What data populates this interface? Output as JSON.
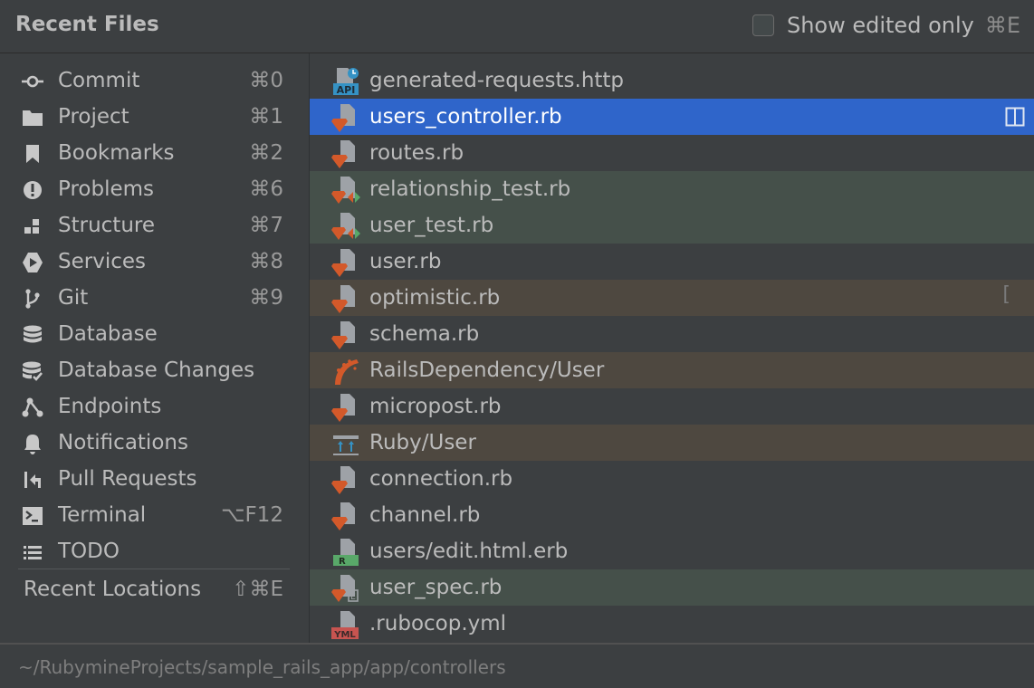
{
  "header": {
    "title": "Recent Files",
    "show_edited_label": "Show edited only",
    "show_edited_shortcut": "⌘E",
    "show_edited_checked": false
  },
  "sidebar": {
    "items": [
      {
        "label": "Commit",
        "shortcut": "⌘0",
        "icon": "commit-icon"
      },
      {
        "label": "Project",
        "shortcut": "⌘1",
        "icon": "folder-icon"
      },
      {
        "label": "Bookmarks",
        "shortcut": "⌘2",
        "icon": "bookmark-icon"
      },
      {
        "label": "Problems",
        "shortcut": "⌘6",
        "icon": "problems-icon"
      },
      {
        "label": "Structure",
        "shortcut": "⌘7",
        "icon": "structure-icon"
      },
      {
        "label": "Services",
        "shortcut": "⌘8",
        "icon": "services-icon"
      },
      {
        "label": "Git",
        "shortcut": "⌘9",
        "icon": "git-branch-icon"
      },
      {
        "label": "Database",
        "shortcut": "",
        "icon": "database-icon"
      },
      {
        "label": "Database Changes",
        "shortcut": "",
        "icon": "database-changes-icon"
      },
      {
        "label": "Endpoints",
        "shortcut": "",
        "icon": "endpoints-icon"
      },
      {
        "label": "Notifications",
        "shortcut": "",
        "icon": "bell-icon"
      },
      {
        "label": "Pull Requests",
        "shortcut": "",
        "icon": "pull-request-icon"
      },
      {
        "label": "Terminal",
        "shortcut": "⌥F12",
        "icon": "terminal-icon"
      },
      {
        "label": "TODO",
        "shortcut": "",
        "icon": "todo-list-icon"
      }
    ],
    "recent_locations": {
      "label": "Recent Locations",
      "shortcut": "⇧⌘E"
    }
  },
  "files": [
    {
      "name": "generated-requests.http",
      "icon": "http-api-file-icon",
      "state": "normal"
    },
    {
      "name": "users_controller.rb",
      "icon": "ruby-file-icon",
      "state": "selected"
    },
    {
      "name": "routes.rb",
      "icon": "ruby-file-icon",
      "state": "normal"
    },
    {
      "name": "relationship_test.rb",
      "icon": "ruby-test-file-icon",
      "state": "green"
    },
    {
      "name": "user_test.rb",
      "icon": "ruby-test-file-icon",
      "state": "green"
    },
    {
      "name": "user.rb",
      "icon": "ruby-file-icon",
      "state": "normal"
    },
    {
      "name": "optimistic.rb",
      "icon": "ruby-file-icon",
      "state": "brown"
    },
    {
      "name": "schema.rb",
      "icon": "ruby-file-icon",
      "state": "normal"
    },
    {
      "name": "RailsDependency/User",
      "icon": "rails-icon",
      "state": "brown"
    },
    {
      "name": "micropost.rb",
      "icon": "ruby-file-icon",
      "state": "normal"
    },
    {
      "name": "Ruby/User",
      "icon": "diagram-icon",
      "state": "brown"
    },
    {
      "name": "connection.rb",
      "icon": "ruby-file-icon",
      "state": "normal"
    },
    {
      "name": "channel.rb",
      "icon": "ruby-file-icon",
      "state": "normal"
    },
    {
      "name": "users/edit.html.erb",
      "icon": "erb-file-icon",
      "state": "normal"
    },
    {
      "name": "user_spec.rb",
      "icon": "rspec-file-icon",
      "state": "green"
    },
    {
      "name": ".rubocop.yml",
      "icon": "yml-file-icon",
      "state": "normal"
    }
  ],
  "footer": {
    "path": "~/RubymineProjects/sample_rails_app/app/controllers"
  },
  "colors": {
    "background": "#3c3f41",
    "selected": "#2f65ca",
    "green_row": "#45504a",
    "brown_row": "#4e4840",
    "ruby_red": "#d3592a"
  }
}
